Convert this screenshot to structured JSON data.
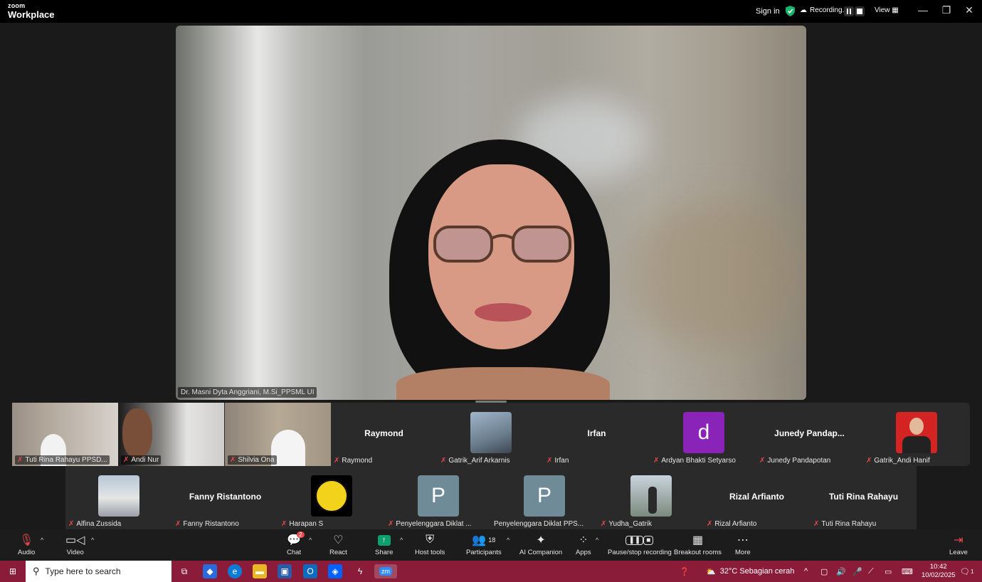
{
  "titlebar": {
    "logo_line1": "zoom",
    "logo_line2": "Workplace",
    "sign_in": "Sign in",
    "recording": "Recording...",
    "view": "View"
  },
  "main_video": {
    "speaker_name": "Dr. Masni Dyta Anggriani, M.Si_PPSML UI"
  },
  "gallery_row1": [
    {
      "label": "Tuti Rina Rahayu PPSD...",
      "kind": "video"
    },
    {
      "label": "Andi Nur",
      "kind": "video"
    },
    {
      "label": "Shilvia Ona",
      "kind": "video"
    },
    {
      "label": "Raymond",
      "bigname": "Raymond",
      "kind": "name"
    },
    {
      "label": "Gatrik_Arif Arkarnis",
      "kind": "photo-couple"
    },
    {
      "label": "Irfan",
      "bigname": "Irfan",
      "kind": "name"
    },
    {
      "label": "Ardyan Bhakti Setyarso",
      "letter": "d",
      "kind": "letter"
    },
    {
      "label": "Junedy Pandapotan",
      "bigname": "Junedy  Pandap...",
      "kind": "name"
    },
    {
      "label": "Gatrik_Andi Hanif",
      "kind": "photo-red"
    }
  ],
  "gallery_row2": [
    {
      "label": "Alfina Zussida",
      "kind": "photo-temple"
    },
    {
      "label": "Fanny Ristantono",
      "bigname": "Fanny Ristantono",
      "kind": "name"
    },
    {
      "label": "Harapan S",
      "kind": "photo-logo"
    },
    {
      "label": "Penyelenggara Diklat ...",
      "letter": "P",
      "kind": "letter"
    },
    {
      "label": "Penyelenggara Diklat PPS...",
      "letter": "P",
      "kind": "letter"
    },
    {
      "label": "Yudha_Gatrik",
      "kind": "photo-man"
    },
    {
      "label": "Rizal Arfianto",
      "bigname": "Rizal Arfianto",
      "kind": "name"
    },
    {
      "label": "Tuti Rina Rahayu",
      "bigname": "Tuti Rina Rahayu",
      "kind": "name"
    }
  ],
  "toolbar": {
    "audio": "Audio",
    "video": "Video",
    "chat": "Chat",
    "chat_badge": "2",
    "react": "React",
    "share": "Share",
    "host_tools": "Host tools",
    "participants": "Participants",
    "participants_count": "18",
    "ai_companion": "AI Companion",
    "apps": "Apps",
    "pause_stop": "Pause/stop recording",
    "breakout": "Breakout rooms",
    "more": "More",
    "leave": "Leave"
  },
  "taskbar": {
    "search_placeholder": "Type here to search",
    "weather": "32°C  Sebagian cerah",
    "time": "10:42",
    "date": "10/02/2025",
    "notif_count": "1"
  },
  "colors": {
    "accent_green": "#0e9f6e",
    "mute_red": "#e5484d",
    "taskbar": "#8a1c3a"
  }
}
